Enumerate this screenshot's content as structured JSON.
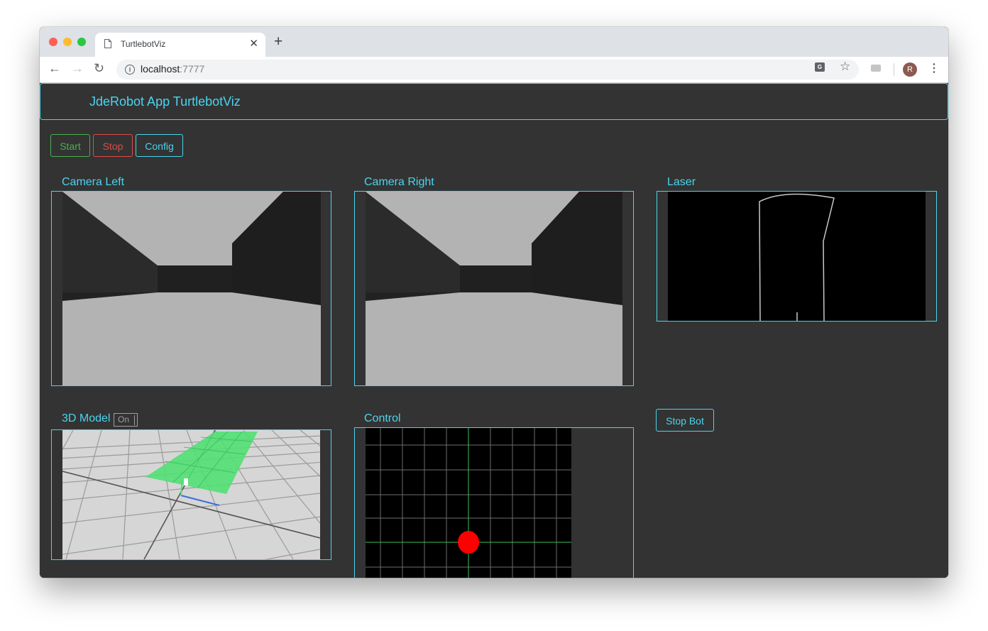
{
  "browser": {
    "tab_title": "TurtlebotViz",
    "new_tab": "+",
    "close_tab": "✕",
    "url_host": "localhost",
    "url_port": ":7777",
    "avatar_letter": "R"
  },
  "app": {
    "title": "JdeRobot App TurtlebotViz"
  },
  "buttons": {
    "start": "Start",
    "stop": "Stop",
    "config": "Config",
    "stop_bot": "Stop Bot"
  },
  "panels": {
    "camera_left": "Camera Left",
    "camera_right": "Camera Right",
    "laser": "Laser",
    "model_3d": "3D Model",
    "model_toggle": "On",
    "control": "Control"
  },
  "colors": {
    "accent": "#4ad4ee",
    "start": "#4caf50",
    "stop": "#e04b4b",
    "control_dot": "#ff0000",
    "path_highlight": "#4ee072"
  }
}
